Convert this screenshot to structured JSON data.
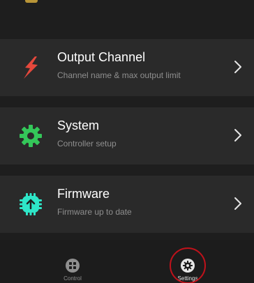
{
  "menu": {
    "items": [
      {
        "title": "Output Channel",
        "subtitle": "Channel name & max output limit",
        "icon": "lightning-icon",
        "color": "#e5483c"
      },
      {
        "title": "System",
        "subtitle": "Controller setup",
        "icon": "gear-icon",
        "color": "#34c759"
      },
      {
        "title": "Firmware",
        "subtitle": "Firmware up to date",
        "icon": "chip-upload-icon",
        "color": "#2ee6c8"
      }
    ]
  },
  "nav": {
    "items": [
      {
        "label": "Control",
        "icon": "grid-icon"
      },
      {
        "label": "Settings",
        "icon": "gear-icon"
      }
    ],
    "active_index": 1
  },
  "colors": {
    "background": "#1e1e1e",
    "card": "#2a2a2a",
    "highlight_ring": "#c0121b"
  }
}
